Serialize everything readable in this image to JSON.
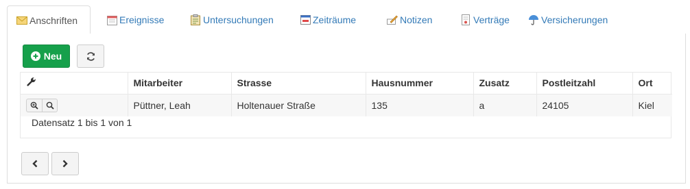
{
  "tabs": [
    {
      "label": "Anschriften",
      "icon": "envelope-icon",
      "active": true
    },
    {
      "label": "Ereignisse",
      "icon": "calendar-icon",
      "active": false
    },
    {
      "label": "Untersuchungen",
      "icon": "clipboard-icon",
      "active": false
    },
    {
      "label": "Zeiträume",
      "icon": "timespan-icon",
      "active": false
    },
    {
      "label": "Notizen",
      "icon": "note-pencil-icon",
      "active": false
    },
    {
      "label": "Verträge",
      "icon": "contract-icon",
      "active": false
    },
    {
      "label": "Versicherungen",
      "icon": "umbrella-icon",
      "active": false
    }
  ],
  "toolbar": {
    "new_label": "Neu",
    "new_icon": "plus-circle-icon",
    "refresh_icon": "refresh-icon"
  },
  "table": {
    "tools_icon": "wrench-icon",
    "columns": [
      "Mitarbeiter",
      "Strasse",
      "Hausnummer",
      "Zusatz",
      "Postleitzahl",
      "Ort"
    ],
    "rows": [
      {
        "mitarbeiter": "Püttner, Leah",
        "strasse": "Holtenauer Straße",
        "hausnummer": "135",
        "zusatz": "a",
        "postleitzahl": "24105",
        "ort": "Kiel"
      }
    ],
    "row_actions": [
      "zoom-in-icon",
      "search-icon"
    ]
  },
  "pagination": {
    "info": "Datensatz 1 bis 1 von 1",
    "prev_icon": "chevron-left-icon",
    "next_icon": "chevron-right-icon"
  },
  "colors": {
    "accent": "#337ab7",
    "new_button": "#16a04b"
  }
}
